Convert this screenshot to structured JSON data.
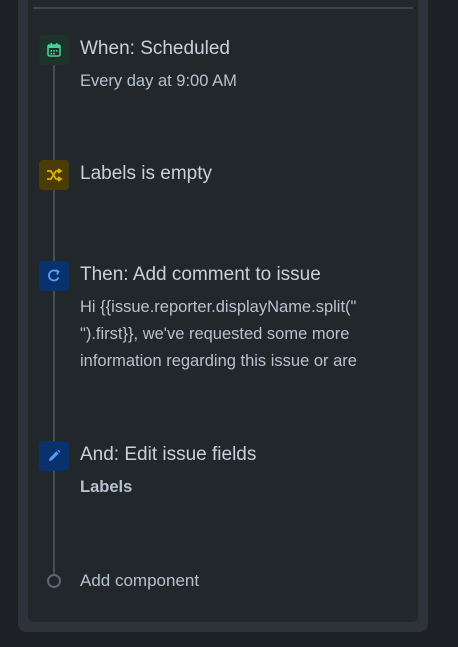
{
  "steps": {
    "trigger": {
      "title": "When: Scheduled",
      "description": "Every day at 9:00 AM",
      "icon": "calendar-icon"
    },
    "condition": {
      "title": "Labels is empty",
      "icon": "shuffle-icon"
    },
    "action_comment": {
      "title": "Then: Add comment to issue",
      "line1": "Hi {{issue.reporter.displayName.split(\"",
      "line2": "\").first}}, we've requested some more",
      "line3": "information regarding this issue or are",
      "icon": "refresh-icon"
    },
    "action_edit": {
      "title": "And: Edit issue fields",
      "field": "Labels",
      "icon": "pencil-icon"
    }
  },
  "add_component": {
    "label": "Add component"
  },
  "colors": {
    "trigger_icon": "#4bce97",
    "condition_icon": "#e2b203",
    "action_icon": "#579dff"
  }
}
